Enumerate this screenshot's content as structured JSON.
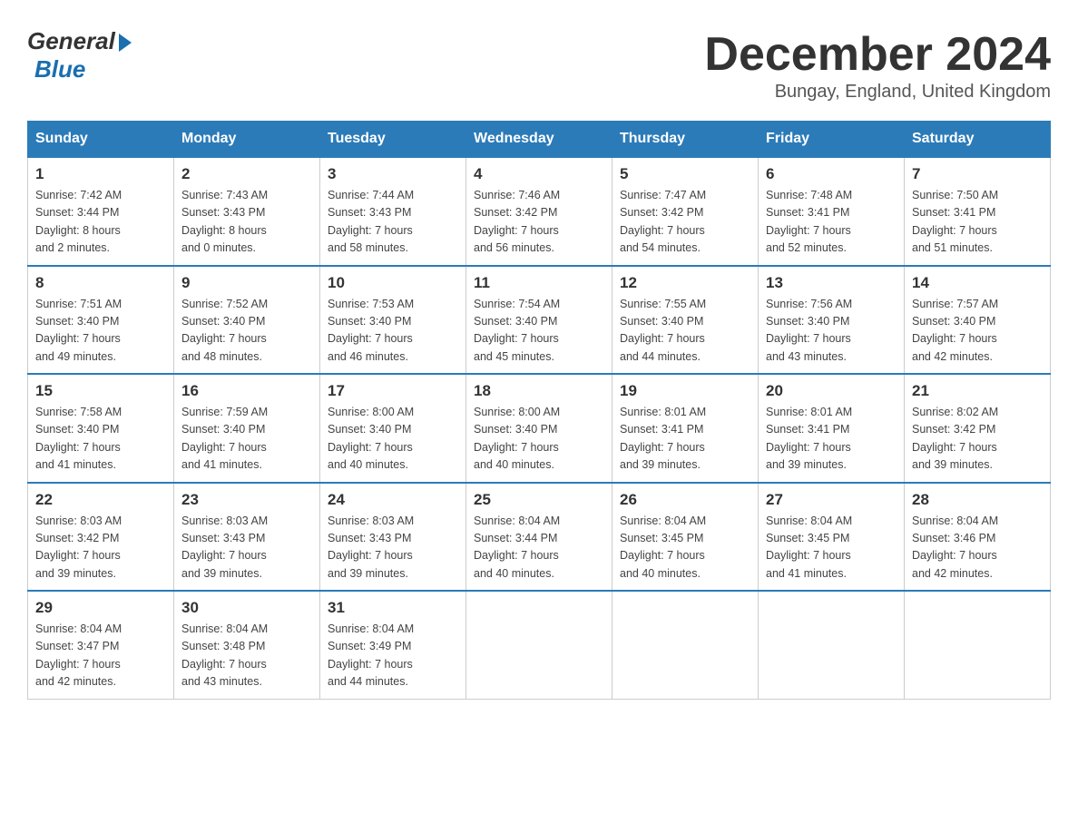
{
  "header": {
    "logo_general": "General",
    "logo_blue": "Blue",
    "month_title": "December 2024",
    "location": "Bungay, England, United Kingdom"
  },
  "days_of_week": [
    "Sunday",
    "Monday",
    "Tuesday",
    "Wednesday",
    "Thursday",
    "Friday",
    "Saturday"
  ],
  "weeks": [
    [
      {
        "day": "1",
        "sunrise": "7:42 AM",
        "sunset": "3:44 PM",
        "daylight": "8 hours and 2 minutes."
      },
      {
        "day": "2",
        "sunrise": "7:43 AM",
        "sunset": "3:43 PM",
        "daylight": "8 hours and 0 minutes."
      },
      {
        "day": "3",
        "sunrise": "7:44 AM",
        "sunset": "3:43 PM",
        "daylight": "7 hours and 58 minutes."
      },
      {
        "day": "4",
        "sunrise": "7:46 AM",
        "sunset": "3:42 PM",
        "daylight": "7 hours and 56 minutes."
      },
      {
        "day": "5",
        "sunrise": "7:47 AM",
        "sunset": "3:42 PM",
        "daylight": "7 hours and 54 minutes."
      },
      {
        "day": "6",
        "sunrise": "7:48 AM",
        "sunset": "3:41 PM",
        "daylight": "7 hours and 52 minutes."
      },
      {
        "day": "7",
        "sunrise": "7:50 AM",
        "sunset": "3:41 PM",
        "daylight": "7 hours and 51 minutes."
      }
    ],
    [
      {
        "day": "8",
        "sunrise": "7:51 AM",
        "sunset": "3:40 PM",
        "daylight": "7 hours and 49 minutes."
      },
      {
        "day": "9",
        "sunrise": "7:52 AM",
        "sunset": "3:40 PM",
        "daylight": "7 hours and 48 minutes."
      },
      {
        "day": "10",
        "sunrise": "7:53 AM",
        "sunset": "3:40 PM",
        "daylight": "7 hours and 46 minutes."
      },
      {
        "day": "11",
        "sunrise": "7:54 AM",
        "sunset": "3:40 PM",
        "daylight": "7 hours and 45 minutes."
      },
      {
        "day": "12",
        "sunrise": "7:55 AM",
        "sunset": "3:40 PM",
        "daylight": "7 hours and 44 minutes."
      },
      {
        "day": "13",
        "sunrise": "7:56 AM",
        "sunset": "3:40 PM",
        "daylight": "7 hours and 43 minutes."
      },
      {
        "day": "14",
        "sunrise": "7:57 AM",
        "sunset": "3:40 PM",
        "daylight": "7 hours and 42 minutes."
      }
    ],
    [
      {
        "day": "15",
        "sunrise": "7:58 AM",
        "sunset": "3:40 PM",
        "daylight": "7 hours and 41 minutes."
      },
      {
        "day": "16",
        "sunrise": "7:59 AM",
        "sunset": "3:40 PM",
        "daylight": "7 hours and 41 minutes."
      },
      {
        "day": "17",
        "sunrise": "8:00 AM",
        "sunset": "3:40 PM",
        "daylight": "7 hours and 40 minutes."
      },
      {
        "day": "18",
        "sunrise": "8:00 AM",
        "sunset": "3:40 PM",
        "daylight": "7 hours and 40 minutes."
      },
      {
        "day": "19",
        "sunrise": "8:01 AM",
        "sunset": "3:41 PM",
        "daylight": "7 hours and 39 minutes."
      },
      {
        "day": "20",
        "sunrise": "8:01 AM",
        "sunset": "3:41 PM",
        "daylight": "7 hours and 39 minutes."
      },
      {
        "day": "21",
        "sunrise": "8:02 AM",
        "sunset": "3:42 PM",
        "daylight": "7 hours and 39 minutes."
      }
    ],
    [
      {
        "day": "22",
        "sunrise": "8:03 AM",
        "sunset": "3:42 PM",
        "daylight": "7 hours and 39 minutes."
      },
      {
        "day": "23",
        "sunrise": "8:03 AM",
        "sunset": "3:43 PM",
        "daylight": "7 hours and 39 minutes."
      },
      {
        "day": "24",
        "sunrise": "8:03 AM",
        "sunset": "3:43 PM",
        "daylight": "7 hours and 39 minutes."
      },
      {
        "day": "25",
        "sunrise": "8:04 AM",
        "sunset": "3:44 PM",
        "daylight": "7 hours and 40 minutes."
      },
      {
        "day": "26",
        "sunrise": "8:04 AM",
        "sunset": "3:45 PM",
        "daylight": "7 hours and 40 minutes."
      },
      {
        "day": "27",
        "sunrise": "8:04 AM",
        "sunset": "3:45 PM",
        "daylight": "7 hours and 41 minutes."
      },
      {
        "day": "28",
        "sunrise": "8:04 AM",
        "sunset": "3:46 PM",
        "daylight": "7 hours and 42 minutes."
      }
    ],
    [
      {
        "day": "29",
        "sunrise": "8:04 AM",
        "sunset": "3:47 PM",
        "daylight": "7 hours and 42 minutes."
      },
      {
        "day": "30",
        "sunrise": "8:04 AM",
        "sunset": "3:48 PM",
        "daylight": "7 hours and 43 minutes."
      },
      {
        "day": "31",
        "sunrise": "8:04 AM",
        "sunset": "3:49 PM",
        "daylight": "7 hours and 44 minutes."
      },
      null,
      null,
      null,
      null
    ]
  ],
  "labels": {
    "sunrise": "Sunrise:",
    "sunset": "Sunset:",
    "daylight": "Daylight:"
  }
}
